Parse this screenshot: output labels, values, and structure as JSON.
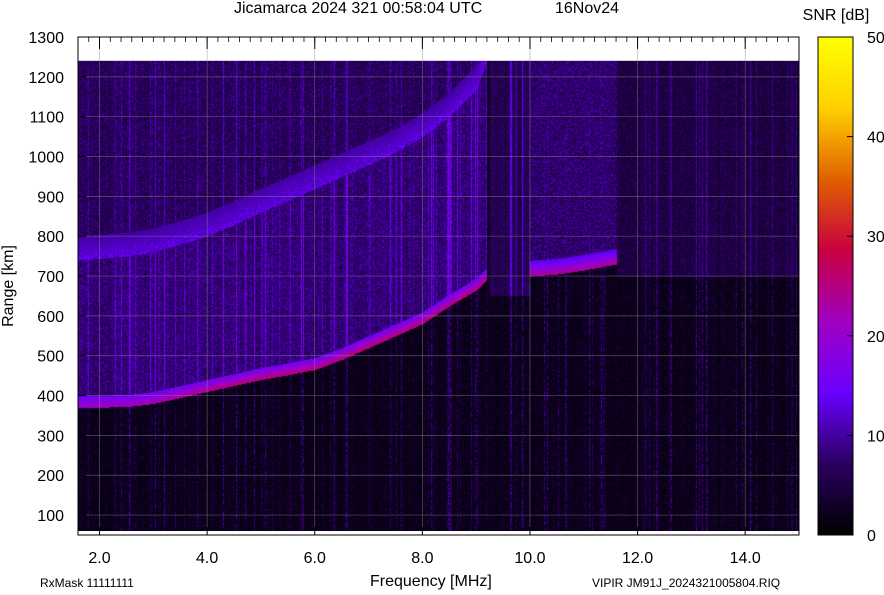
{
  "header": {
    "title": "Jicamarca 2024 321 00:58:04 UTC",
    "date": "16Nov24"
  },
  "footer": {
    "rxmask": "RxMask 11111111",
    "filename": "VIPIR  JM91J_2024321005804.RIQ"
  },
  "chart_data": {
    "type": "heatmap",
    "title": "Jicamarca 2024 321 00:58:04 UTC",
    "xlabel": "Frequency [MHz]",
    "ylabel": "Range [km]",
    "xlim": [
      1.6,
      15.0
    ],
    "ylim": [
      50,
      1300
    ],
    "xticks": [
      2.0,
      4.0,
      6.0,
      8.0,
      10.0,
      12.0,
      14.0
    ],
    "xtick_labels": [
      "2.0",
      "4.0",
      "6.0",
      "8.0",
      "10.0",
      "12.0",
      "14.0"
    ],
    "yticks": [
      100,
      200,
      300,
      400,
      500,
      600,
      700,
      800,
      900,
      1000,
      1100,
      1200,
      1300
    ],
    "ytick_labels": [
      "100",
      "200",
      "300",
      "400",
      "500",
      "600",
      "700",
      "800",
      "900",
      "1000",
      "1100",
      "1200",
      "1300"
    ],
    "grid": true,
    "colorbar": {
      "label": "SNR [dB]",
      "range": [
        0,
        50
      ],
      "ticks": [
        0,
        10,
        20,
        30,
        40,
        50
      ],
      "tick_labels": [
        "0",
        "10",
        "20",
        "30",
        "40",
        "50"
      ],
      "colors": [
        "#000000",
        "#2a0060",
        "#6a00ff",
        "#a000c0",
        "#c80040",
        "#e06000",
        "#ffd000",
        "#ffff00"
      ]
    },
    "data_extent": {
      "x": [
        1.6,
        15.0
      ],
      "y": [
        60,
        1240
      ]
    },
    "series": [
      {
        "name": "F-layer trace (1st hop)",
        "points": [
          [
            1.6,
            370
          ],
          [
            2.5,
            372
          ],
          [
            3.0,
            380
          ],
          [
            3.5,
            395
          ],
          [
            4.0,
            410
          ],
          [
            4.5,
            425
          ],
          [
            5.0,
            440
          ],
          [
            5.5,
            452
          ],
          [
            6.0,
            465
          ],
          [
            6.5,
            490
          ],
          [
            7.0,
            520
          ],
          [
            7.5,
            550
          ],
          [
            8.0,
            580
          ],
          [
            8.5,
            625
          ],
          [
            9.0,
            665
          ],
          [
            9.2,
            690
          ]
        ],
        "peak_snr_db": 28
      },
      {
        "name": "trace (2nd hop)",
        "points": [
          [
            1.6,
            740
          ],
          [
            2.5,
            750
          ],
          [
            3.0,
            760
          ],
          [
            3.5,
            780
          ],
          [
            4.0,
            800
          ],
          [
            4.5,
            830
          ],
          [
            5.0,
            860
          ],
          [
            5.5,
            890
          ],
          [
            6.0,
            920
          ],
          [
            7.0,
            980
          ],
          [
            7.5,
            1010
          ],
          [
            8.0,
            1050
          ],
          [
            8.5,
            1100
          ],
          [
            9.0,
            1170
          ],
          [
            9.2,
            1240
          ]
        ],
        "peak_snr_db": 13
      },
      {
        "name": "trace above 10 MHz",
        "points": [
          [
            10.0,
            700
          ],
          [
            10.5,
            705
          ],
          [
            11.0,
            715
          ],
          [
            11.6,
            730
          ]
        ],
        "peak_snr_db": 27
      }
    ]
  }
}
